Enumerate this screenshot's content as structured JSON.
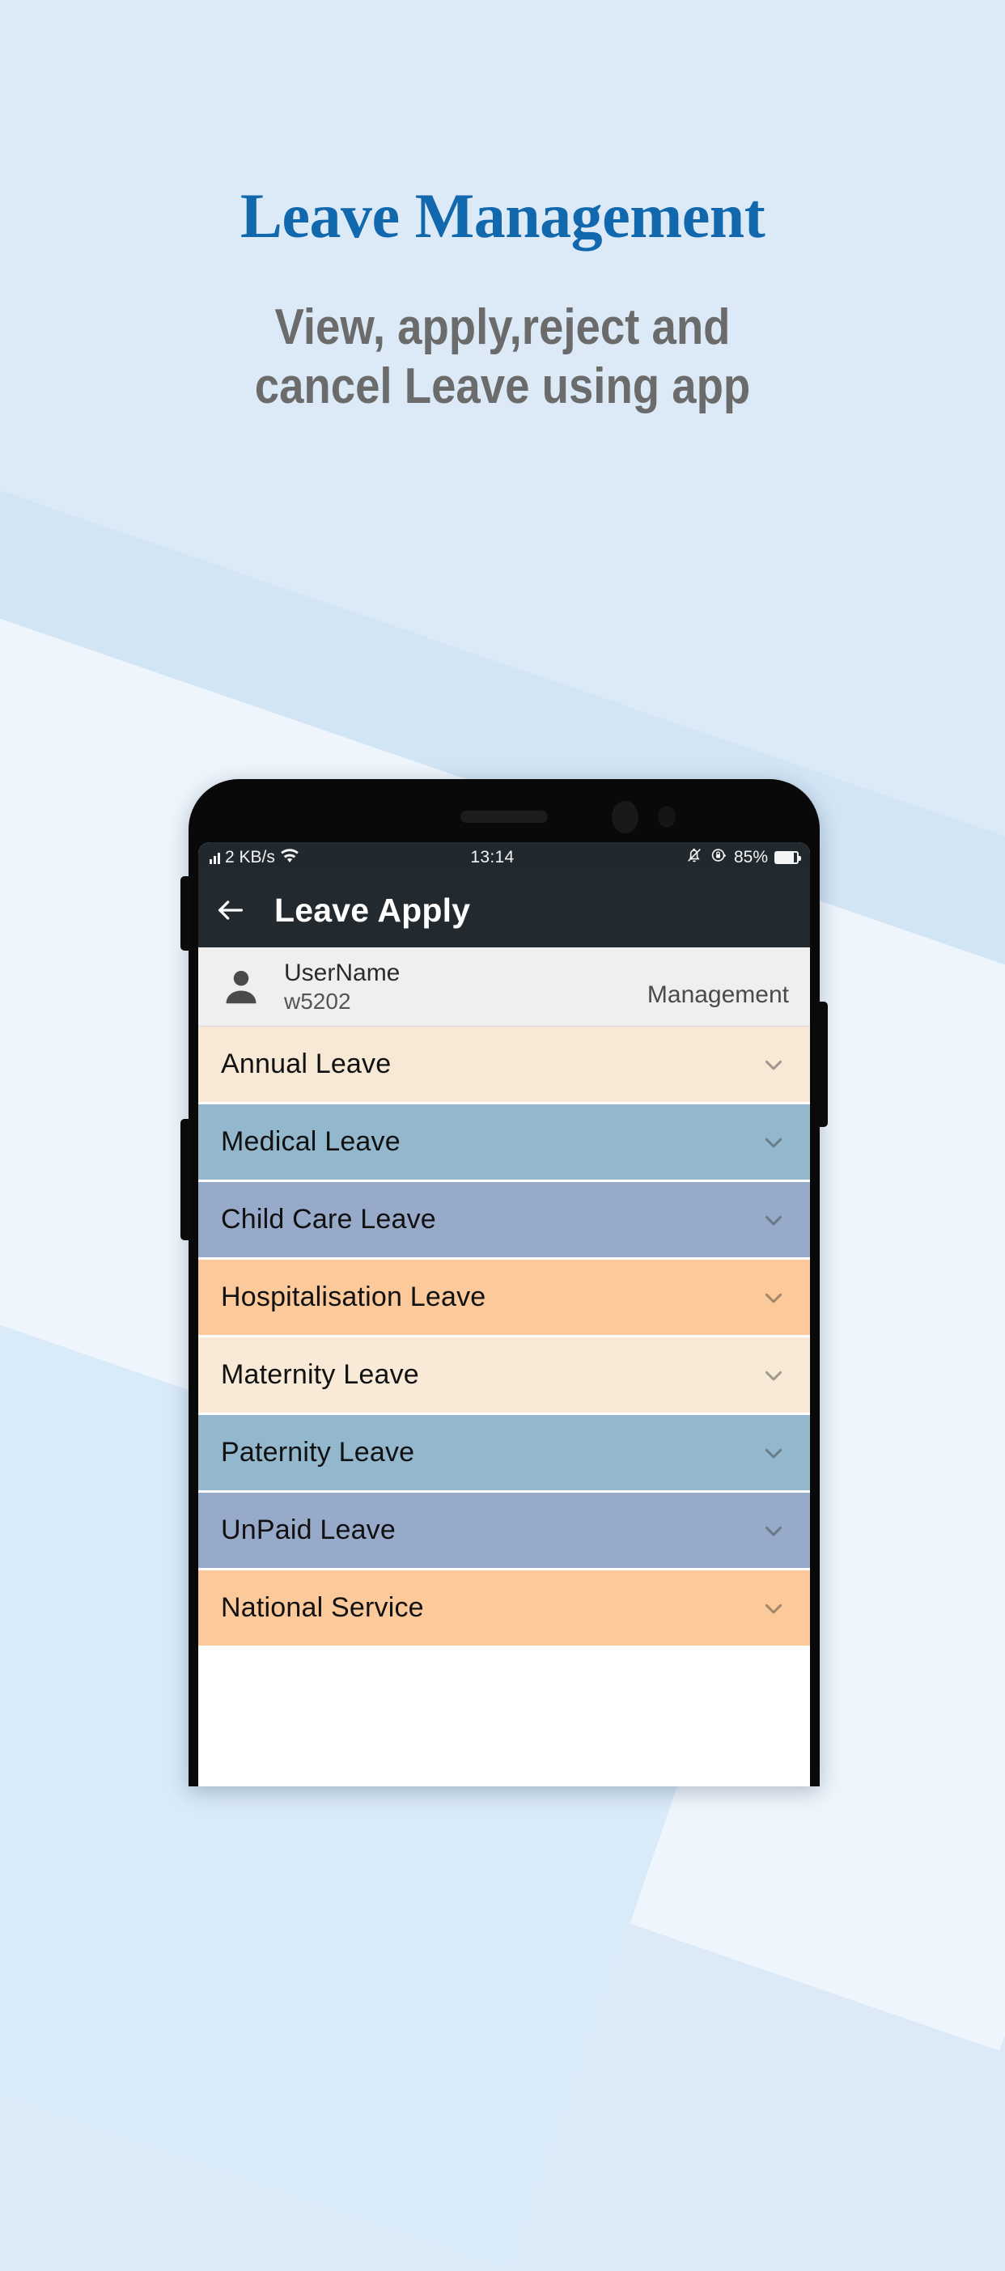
{
  "promo": {
    "title": "Leave Management",
    "subtitle": "View, apply,reject and\ncancel Leave using app",
    "title_color": "#1268ad",
    "subtitle_color": "#6b6b6b",
    "background_color": "#dceaf7"
  },
  "phone": {
    "status_bar": {
      "network_speed": "2 KB/s",
      "wifi_icon": "wifi-icon",
      "signal_icon": "signal-bars-icon",
      "time": "13:14",
      "mute_icon": "bell-muted-icon",
      "rotation_lock_icon": "rotation-lock-icon",
      "battery_percent": "85%",
      "battery_icon": "battery-icon",
      "background_color": "#22292e"
    },
    "app_bar": {
      "back_icon": "back-arrow-icon",
      "title": "Leave Apply",
      "background_color": "#222a2f"
    },
    "user": {
      "avatar_icon": "person-icon",
      "name": "UserName",
      "id": "w5202",
      "role": "Management",
      "background_color": "#efefef"
    },
    "leave_types": [
      {
        "label": "Annual Leave",
        "color": "#f7e9d6",
        "chevron": "chevron-down-icon"
      },
      {
        "label": "Medical Leave",
        "color": "#93b8cd",
        "chevron": "chevron-down-icon"
      },
      {
        "label": "Child Care Leave",
        "color": "#97aac9",
        "chevron": "chevron-down-icon"
      },
      {
        "label": "Hospitalisation Leave",
        "color": "#fbc99a",
        "chevron": "chevron-down-icon"
      },
      {
        "label": "Maternity Leave",
        "color": "#f8ead7",
        "chevron": "chevron-down-icon"
      },
      {
        "label": "Paternity Leave",
        "color": "#93b8cd",
        "chevron": "chevron-down-icon"
      },
      {
        "label": "UnPaid Leave",
        "color": "#97aac9",
        "chevron": "chevron-down-icon"
      },
      {
        "label": "National Service",
        "color": "#fbc99a",
        "chevron": "chevron-down-icon"
      }
    ]
  }
}
